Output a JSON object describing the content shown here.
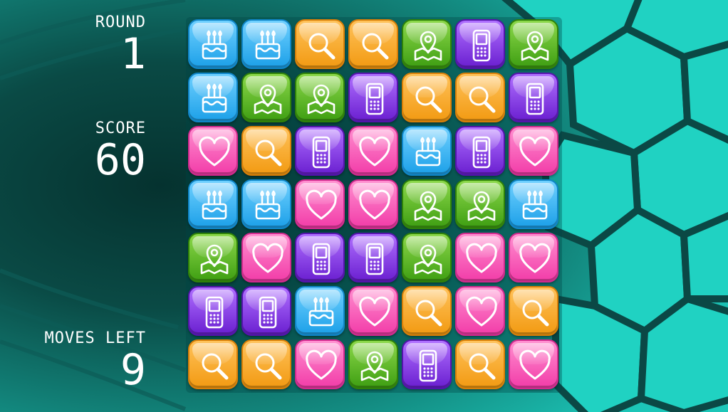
{
  "hud": {
    "round_label": "ROUND",
    "round_value": "1",
    "score_label": "SCORE",
    "score_value": "60",
    "moves_label": "MOVES LEFT",
    "moves_value": "9"
  },
  "colors": {
    "background_dark": "#0a3d3a",
    "background_teal": "#1cc6b8",
    "cake_tile": "#1ca0e8",
    "search_tile": "#f29a12",
    "map_tile": "#3e9e12",
    "phone_tile": "#6a1fd0",
    "heart_tile": "#f23ca8"
  },
  "board": {
    "rows": 7,
    "cols": 7,
    "grid": [
      [
        "cake",
        "cake",
        "search",
        "search",
        "map",
        "phone",
        "map"
      ],
      [
        "cake",
        "map",
        "map",
        "phone",
        "search",
        "search",
        "phone"
      ],
      [
        "heart",
        "search",
        "phone",
        "heart",
        "cake",
        "phone",
        "heart"
      ],
      [
        "cake",
        "cake",
        "heart",
        "heart",
        "map",
        "map",
        "cake"
      ],
      [
        "map",
        "heart",
        "phone",
        "phone",
        "map",
        "heart",
        "heart"
      ],
      [
        "phone",
        "phone",
        "cake",
        "heart",
        "search",
        "heart",
        "search"
      ],
      [
        "search",
        "search",
        "heart",
        "map",
        "phone",
        "search",
        "heart"
      ]
    ],
    "icons": {
      "cake": "birthday-cake-icon",
      "search": "magnifier-icon",
      "map": "map-pin-icon",
      "phone": "mobile-phone-icon",
      "heart": "heart-icon"
    }
  }
}
